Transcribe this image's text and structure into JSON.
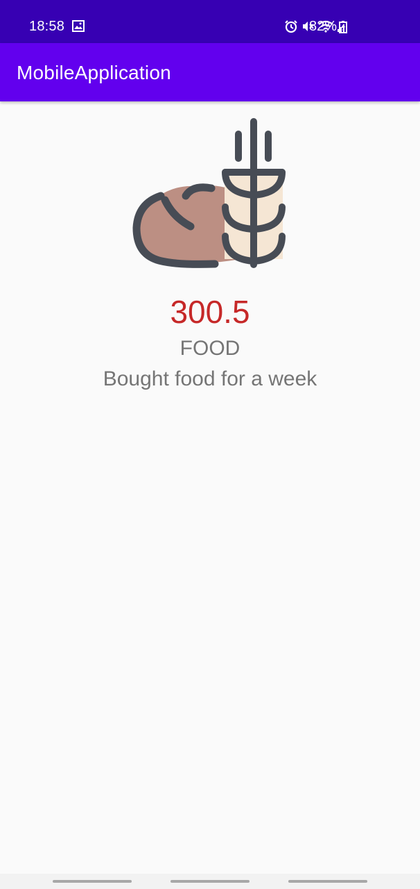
{
  "status_bar": {
    "time": "18:58",
    "battery": "82%",
    "icons": [
      "gallery-icon",
      "alarm-icon",
      "mute-icon",
      "wifi-icon",
      "signal-icon",
      "battery-charging-icon"
    ]
  },
  "app_bar": {
    "title": "MobileApplication"
  },
  "expense": {
    "icon": "bread-wheat-icon",
    "amount": "300.5",
    "category": "FOOD",
    "description": "Bought food for a week"
  },
  "navigation_bar": {
    "items": [
      "recent-apps",
      "home",
      "back"
    ]
  },
  "colors": {
    "status_bar": "#3700b3",
    "app_bar": "#6200ee",
    "amount": "#c62828",
    "secondary_text": "#757575",
    "background": "#fafafa"
  }
}
